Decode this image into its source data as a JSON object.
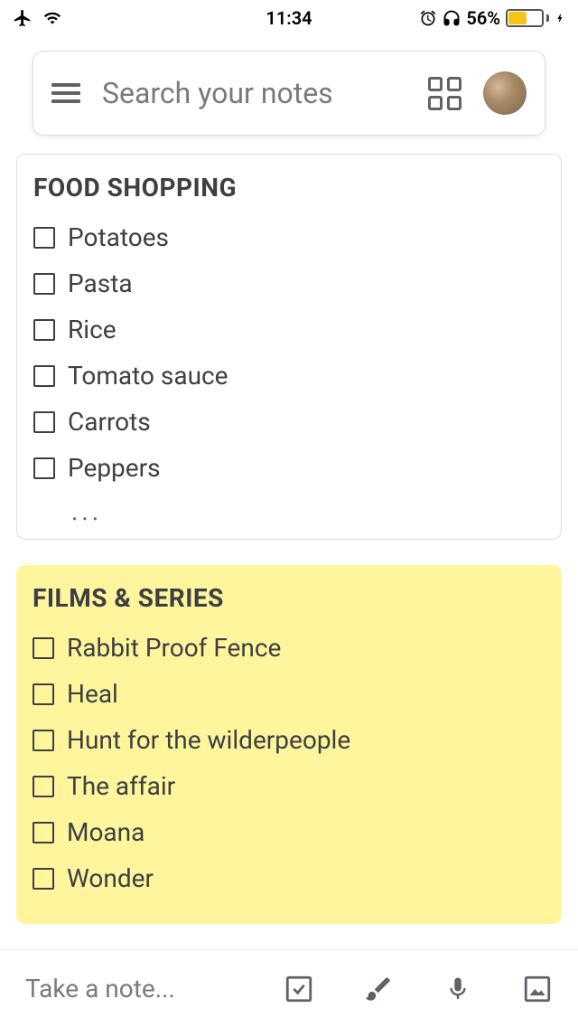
{
  "status_bar": {
    "time": "11:34",
    "battery_percent": "56%"
  },
  "search": {
    "placeholder": "Search your notes"
  },
  "notes": [
    {
      "title": "FOOD SHOPPING",
      "color": "white",
      "show_ellipsis": true,
      "items": [
        {
          "text": "Potatoes",
          "checked": false
        },
        {
          "text": "Pasta",
          "checked": false
        },
        {
          "text": "Rice",
          "checked": false
        },
        {
          "text": "Tomato sauce",
          "checked": false
        },
        {
          "text": "Carrots",
          "checked": false
        },
        {
          "text": "Peppers",
          "checked": false
        }
      ]
    },
    {
      "title": "FILMS & SERIES",
      "color": "yellow",
      "show_ellipsis": false,
      "items": [
        {
          "text": "Rabbit Proof Fence",
          "checked": false
        },
        {
          "text": "Heal",
          "checked": false
        },
        {
          "text": "Hunt for the wilderpeople",
          "checked": false
        },
        {
          "text": "The affair",
          "checked": false
        },
        {
          "text": "Moana",
          "checked": false
        },
        {
          "text": "Wonder",
          "checked": false
        }
      ]
    }
  ],
  "bottom_bar": {
    "placeholder": "Take a note..."
  },
  "ellipsis": "..."
}
